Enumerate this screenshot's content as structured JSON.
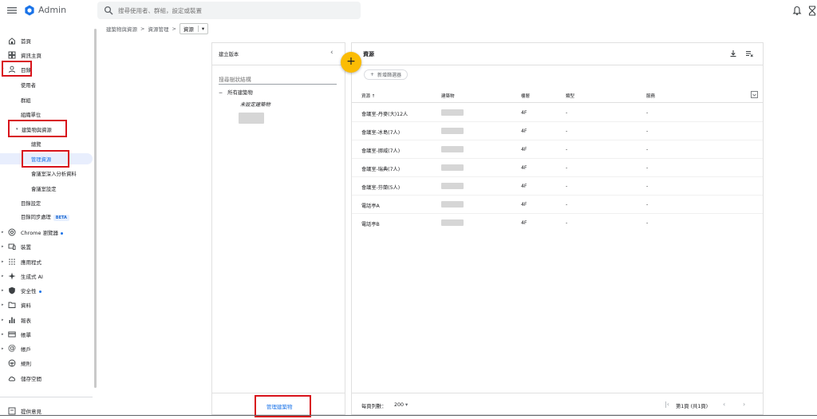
{
  "topbar": {
    "app_title": "Admin",
    "search_placeholder": "搜尋使用者、群組，設定或裝置"
  },
  "breadcrumb": {
    "items": [
      "建築物與資源",
      "資源管理"
    ],
    "separator": ">",
    "current": "資源"
  },
  "sidebar": {
    "items": [
      {
        "label": "首頁",
        "icon": "home-icon"
      },
      {
        "label": "資訊主頁",
        "icon": "dashboard-icon"
      },
      {
        "label": "目錄",
        "icon": "person-icon"
      },
      {
        "label": "使用者"
      },
      {
        "label": "群組"
      },
      {
        "label": "組織單位"
      },
      {
        "label": "建築物與資源"
      },
      {
        "label": "總覽"
      },
      {
        "label": "管理資源"
      },
      {
        "label": "會議室深入分析資料"
      },
      {
        "label": "會議室設定"
      },
      {
        "label": "目錄設定"
      },
      {
        "label": "目錄同步處理",
        "badge": "BETA"
      },
      {
        "label": "Chrome 瀏覽器",
        "icon": "chrome-icon"
      },
      {
        "label": "裝置",
        "icon": "devices-icon"
      },
      {
        "label": "應用程式",
        "icon": "apps-grid-icon"
      },
      {
        "label": "生成式 AI",
        "icon": "sparkle-icon"
      },
      {
        "label": "安全性",
        "icon": "shield-icon"
      },
      {
        "label": "資料",
        "icon": "folder-icon"
      },
      {
        "label": "報表",
        "icon": "bar-chart-icon"
      },
      {
        "label": "帳單",
        "icon": "card-icon"
      },
      {
        "label": "帳戶",
        "icon": "at-icon"
      },
      {
        "label": "規則",
        "icon": "rules-icon"
      },
      {
        "label": "儲存空間",
        "icon": "cloud-icon"
      }
    ],
    "feedback": "提供意見"
  },
  "buildings_panel": {
    "title": "建立版本",
    "search_placeholder": "搜尋樹狀結構",
    "tree_root": "所有建築物",
    "tree_child": "未設定建築物",
    "manage_link": "管理建築物"
  },
  "resources_panel": {
    "title": "資源",
    "add_filter": "新增篩選器",
    "columns": [
      "資源",
      "建築物",
      "樓層",
      "類型",
      "服務"
    ],
    "rows": [
      {
        "resource": "會議室-丹麥(大)12人",
        "floor": "4F",
        "type": "-",
        "service": "-"
      },
      {
        "resource": "會議室-冰島(7人)",
        "floor": "4F",
        "type": "-",
        "service": "-"
      },
      {
        "resource": "會議室-挪威(7人)",
        "floor": "4F",
        "type": "-",
        "service": "-"
      },
      {
        "resource": "會議室-瑞典(7人)",
        "floor": "4F",
        "type": "-",
        "service": "-"
      },
      {
        "resource": "會議室-芬蘭(5人)",
        "floor": "4F",
        "type": "-",
        "service": "-"
      },
      {
        "resource": "電話亭A",
        "floor": "4F",
        "type": "-",
        "service": "-"
      },
      {
        "resource": "電話亭B",
        "floor": "4F",
        "type": "-",
        "service": "-"
      }
    ],
    "rows_per_page_label": "每頁列數：",
    "rows_per_page": "200",
    "page_info": "第1頁 (共1頁)"
  },
  "colors": {
    "accent": "#1a73e8",
    "highlight": "#d8131b",
    "fab": "#fbbc04",
    "selected_bg": "#e8eefd"
  }
}
